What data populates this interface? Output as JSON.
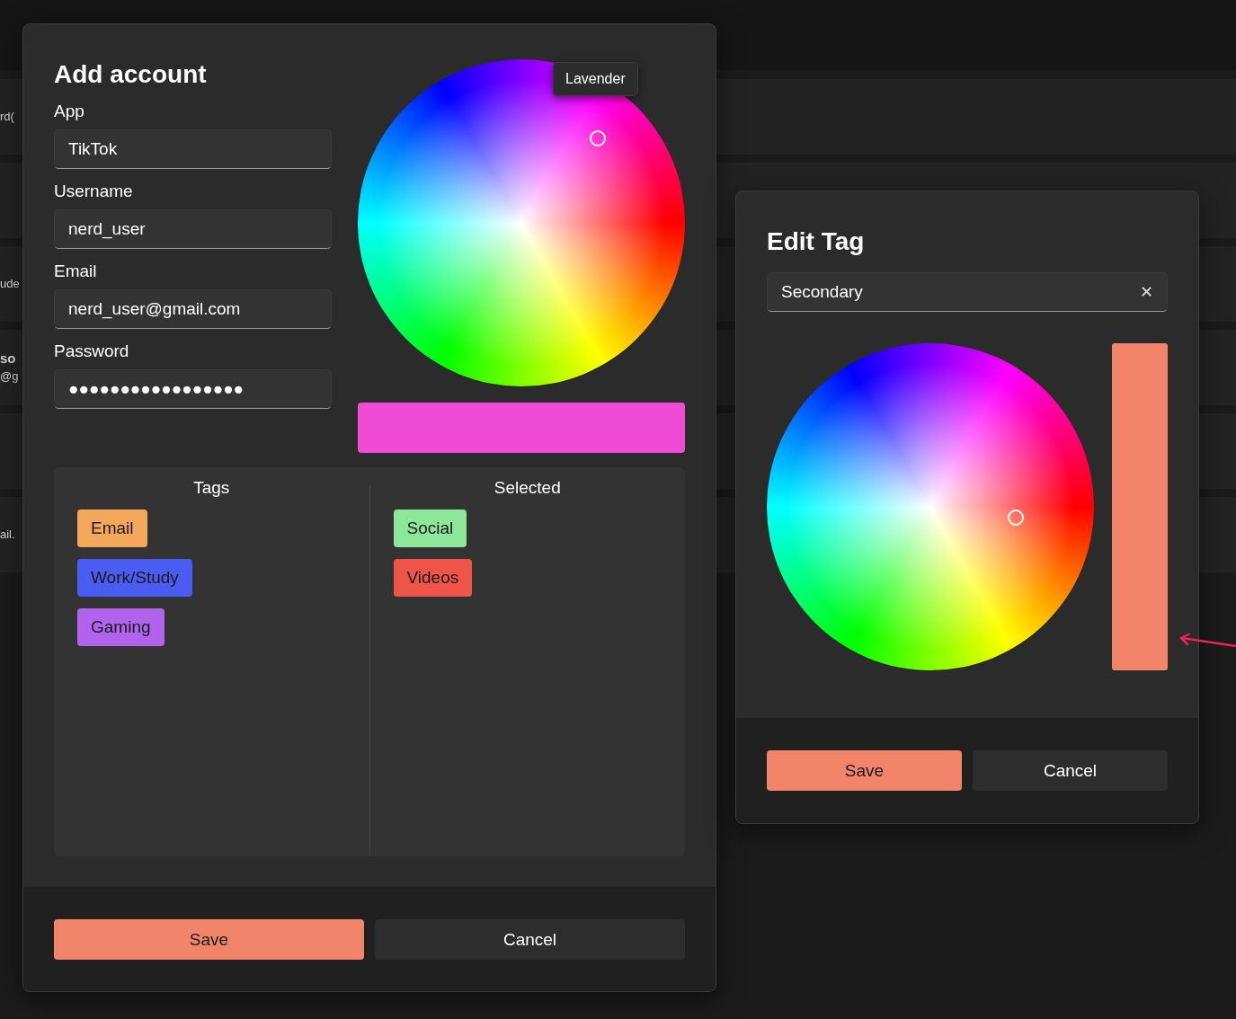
{
  "background_rows": [
    {
      "text": "rd("
    },
    {},
    {
      "text": "ude"
    },
    {
      "text": "so",
      "subtext": "@g"
    },
    {},
    {
      "text": "ail."
    }
  ],
  "add_account": {
    "title": "Add account",
    "fields": [
      {
        "label": "App",
        "value": "TikTok"
      },
      {
        "label": "Username",
        "value": "nerd_user"
      },
      {
        "label": "Email",
        "value": "nerd_user@gmail.com"
      },
      {
        "label": "Password",
        "value": "●●●●●●●●●●●●●●●●●"
      }
    ],
    "color_tooltip": "Lavender",
    "tags": {
      "heading": "Tags",
      "items": [
        {
          "label": "Email",
          "color": "#f5a75b"
        },
        {
          "label": "Work/Study",
          "color": "#4b5cf2"
        },
        {
          "label": "Gaming",
          "color": "#b263ee"
        }
      ]
    },
    "selected": {
      "heading": "Selected",
      "items": [
        {
          "label": "Social",
          "color": "#8de79a"
        },
        {
          "label": "Videos",
          "color": "#ee5548"
        }
      ]
    },
    "buttons": [
      "Save",
      "Cancel"
    ]
  },
  "edit_tag": {
    "title": "Edit Tag",
    "name_value": "Secondary",
    "clear": "✕",
    "buttons": [
      "Save",
      "Cancel"
    ]
  }
}
